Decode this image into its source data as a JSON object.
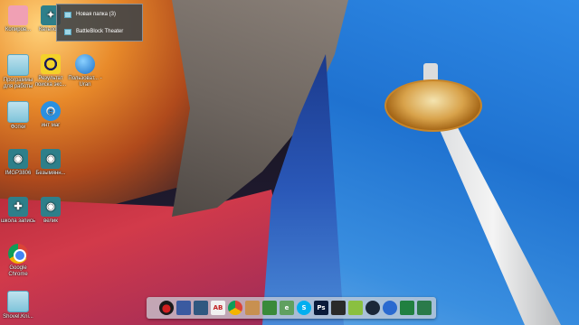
{
  "desktop": {
    "icons": [
      {
        "label": "Копиров...",
        "icon": "pink-app-icon"
      },
      {
        "label": "Катьлог...",
        "icon": "teal-shortcut-icon"
      },
      {
        "label": "Программы для работы",
        "icon": "folder-icon"
      },
      {
        "label": "Результат поиска экс...",
        "icon": "target-icon"
      },
      {
        "label": "Пользоват... - Uran",
        "icon": "globe-icon"
      },
      {
        "label": "Фотки",
        "icon": "folder-icon"
      },
      {
        "label": "инт маг",
        "icon": "internet-explorer-icon"
      },
      {
        "label": "IMGP3806",
        "icon": "camera-icon"
      },
      {
        "label": "Безымянн...",
        "icon": "camera-icon"
      },
      {
        "label": "школа запись",
        "icon": "people-icon"
      },
      {
        "label": "велик",
        "icon": "camera-icon"
      },
      {
        "label": "Google Chrome",
        "icon": "chrome-icon"
      },
      {
        "label": "Shovel.Kni...",
        "icon": "folder-icon"
      }
    ]
  },
  "jump_menu": {
    "items": [
      {
        "label": "Новая папка (3)"
      },
      {
        "label": "BattleBlock Theater"
      }
    ]
  },
  "dock": {
    "items": [
      {
        "name": "record-icon",
        "glyph": "●",
        "color": "#d02020"
      },
      {
        "name": "colorful-app-icon",
        "glyph": "",
        "color": "#3a5aa0"
      },
      {
        "name": "game-icon",
        "glyph": "",
        "color": "#305880"
      },
      {
        "name": "abnet-icon",
        "glyph": "AB",
        "color": "#f0f0f0"
      },
      {
        "name": "chrome-icon",
        "glyph": "",
        "color": "#ffffff"
      },
      {
        "name": "character-icon",
        "glyph": "",
        "color": "#c89050"
      },
      {
        "name": "utility-icon",
        "glyph": "",
        "color": "#3a8a3a"
      },
      {
        "name": "notepad-icon",
        "glyph": "e",
        "color": "#60a060"
      },
      {
        "name": "skype-icon",
        "glyph": "S",
        "color": "#00aff0"
      },
      {
        "name": "photoshop-icon",
        "glyph": "Ps",
        "color": "#0a1a3a"
      },
      {
        "name": "terminal-icon",
        "glyph": "",
        "color": "#2a2a2a"
      },
      {
        "name": "bluestacks-icon",
        "glyph": "",
        "color": "#8ac040"
      },
      {
        "name": "steam-icon",
        "glyph": "",
        "color": "#1b2838"
      },
      {
        "name": "browser-icon",
        "glyph": "",
        "color": "#2a6ad0"
      },
      {
        "name": "game-controller-icon",
        "glyph": "",
        "color": "#208040"
      },
      {
        "name": "monitor-icon",
        "glyph": "",
        "color": "#2a7a4a"
      }
    ]
  }
}
